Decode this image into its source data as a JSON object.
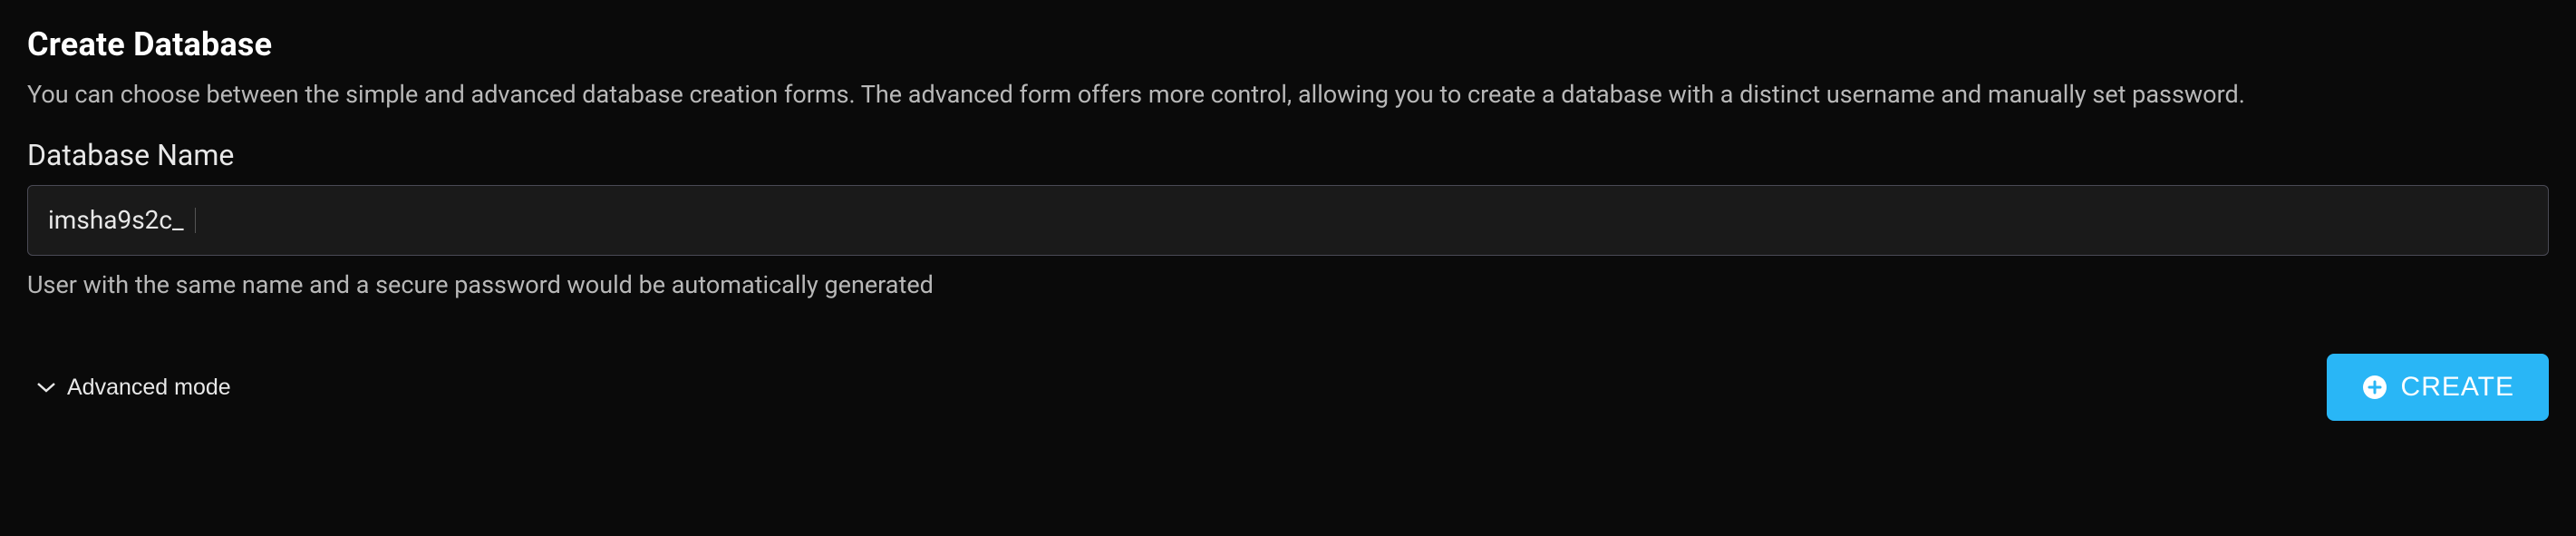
{
  "header": {
    "title": "Create Database",
    "description": "You can choose between the simple and advanced database creation forms. The advanced form offers more control, allowing you to create a database with a distinct username and manually set password."
  },
  "form": {
    "databaseName": {
      "label": "Database Name",
      "prefix": "imsha9s2c_",
      "value": "",
      "helper": "User with the same name and a secure password would be automatically generated"
    }
  },
  "actions": {
    "advancedToggle": "Advanced mode",
    "createLabel": "CREATE"
  },
  "colors": {
    "accent": "#29b6f6",
    "bg": "#0a0a0a",
    "inputBg": "#1a1a1a",
    "border": "#4a4a55",
    "textPrimary": "#ffffff",
    "textSecondary": "#b8b8b8"
  }
}
